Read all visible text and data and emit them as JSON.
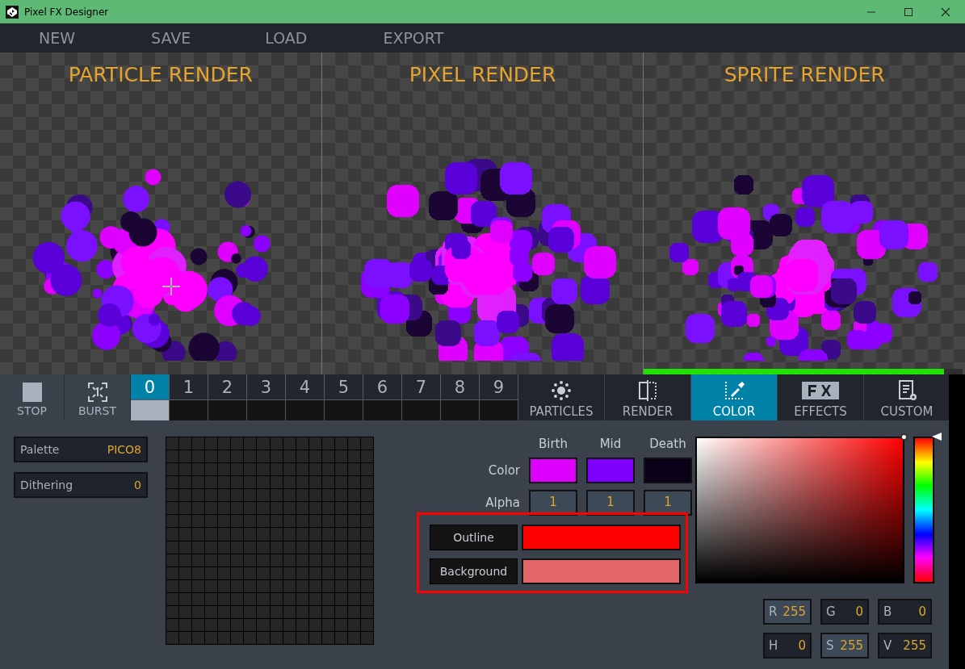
{
  "window": {
    "title": "Pixel FX Designer"
  },
  "menu": [
    "NEW",
    "SAVE",
    "LOAD",
    "EXPORT"
  ],
  "render_panels": [
    {
      "kind": "particle",
      "title": "PARTICLE RENDER"
    },
    {
      "kind": "pixel",
      "title": "PIXEL RENDER"
    },
    {
      "kind": "sprite",
      "title": "SPRITE RENDER",
      "progress": {
        "level": 0.94
      }
    }
  ],
  "controls": [
    {
      "kind": "stop",
      "label": "STOP"
    },
    {
      "kind": "burst",
      "label": "BURST"
    }
  ],
  "slots": [
    {
      "label": "0",
      "selected": true,
      "filled": true
    },
    {
      "label": "1",
      "selected": false,
      "filled": false
    },
    {
      "label": "2",
      "selected": false,
      "filled": false
    },
    {
      "label": "3",
      "selected": false,
      "filled": false
    },
    {
      "label": "4",
      "selected": false,
      "filled": false
    },
    {
      "label": "5",
      "selected": false,
      "filled": false
    },
    {
      "label": "6",
      "selected": false,
      "filled": false
    },
    {
      "label": "7",
      "selected": false,
      "filled": false
    },
    {
      "label": "8",
      "selected": false,
      "filled": false
    },
    {
      "label": "9",
      "selected": false,
      "filled": false
    }
  ],
  "tabs": [
    {
      "kind": "particles",
      "label": "PARTICLES",
      "selected": false
    },
    {
      "kind": "render",
      "label": "RENDER",
      "selected": false
    },
    {
      "kind": "color",
      "label": "COLOR",
      "selected": true
    },
    {
      "kind": "effects",
      "label": "EFFECTS",
      "selected": false
    },
    {
      "kind": "custom",
      "label": "CUSTOM",
      "selected": false
    }
  ],
  "palette_settings": [
    {
      "label": "Palette",
      "value": "PICO8"
    },
    {
      "label": "Dithering",
      "value": "0"
    }
  ],
  "color_stops": {
    "columns": [
      "Birth",
      "Mid",
      "Death"
    ],
    "color_label": "Color",
    "alpha_label": "Alpha",
    "stops": [
      {
        "color": "#dd00ff",
        "alpha": "1"
      },
      {
        "color": "#7f00ff",
        "alpha": "1"
      },
      {
        "color": "#0a0018",
        "alpha": "1"
      }
    ]
  },
  "extra_colors": {
    "highlighted": true,
    "items": [
      {
        "label": "Outline",
        "color": "#ff0000"
      },
      {
        "label": "Background",
        "color": "#e3666a"
      }
    ]
  },
  "color_picker": {
    "hue_slider": {
      "level": 0
    },
    "fields": [
      {
        "label": "R",
        "value": "255"
      },
      {
        "label": "G",
        "value": "0"
      },
      {
        "label": "B",
        "value": "0"
      },
      {
        "label": "H",
        "value": "0"
      },
      {
        "label": "S",
        "value": "255"
      },
      {
        "label": "V",
        "value": "255"
      }
    ]
  }
}
